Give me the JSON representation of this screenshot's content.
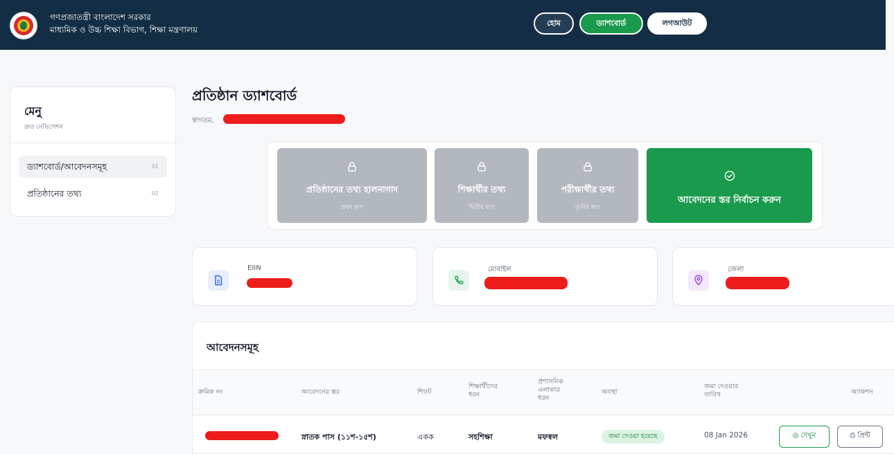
{
  "header": {
    "gov_title": "গণপ্রজাতন্ত্রী বাংলাদেশ সরকার",
    "gov_subtitle": "মাধ্যমিক ও উচ্চ শিক্ষা বিভাগ, শিক্ষা মন্ত্রণালয়",
    "nav": {
      "home": "হোম",
      "dashboard": "ড্যাশবোর্ড",
      "logout": "লগআউট"
    }
  },
  "sidebar": {
    "title": "মেনু",
    "subtitle": "দ্রুত নেভিগেশন",
    "items": [
      {
        "label": "ড্যাশবোর্ড/আবেদনসমূহ",
        "num": "01"
      },
      {
        "label": "প্রতিষ্ঠানের তথ্য",
        "num": "02"
      }
    ]
  },
  "main": {
    "title": "প্রতিষ্ঠান ড্যাশবোর্ড",
    "welcome": "স্বাগতম,"
  },
  "steps": [
    {
      "title": "প্রতিষ্ঠানের তথ্য হালনাগাদ",
      "subtitle": "প্রথম ধাপ"
    },
    {
      "title": "শিক্ষার্থীর তথ্য",
      "subtitle": "দ্বিতীয় ধাপ"
    },
    {
      "title": "পরীক্ষার্থীর তথ্য",
      "subtitle": "তৃতীয় ধাপ"
    },
    {
      "title": "আবেদনের স্তর নির্বাচন করুন"
    }
  ],
  "info": {
    "eiin_label": "EIIN",
    "mobile_label": "মোবাইল",
    "district_label": "জেলা"
  },
  "applications": {
    "title": "আবেদনসমূহ",
    "columns": {
      "serial": "ক্রমিক নং",
      "level": "আবেদনের স্তর",
      "shift": "শিফট",
      "student_type_1": "শিক্ষার্থীদের",
      "student_type_2": "ধরন",
      "area_1": "প্রশাসনিক",
      "area_2": "এলাকার",
      "area_3": "ধরন",
      "status": "অবস্থা",
      "date_1": "জমা দেওয়ার",
      "date_2": "তারিখ",
      "action": "অ্যাকশন"
    },
    "rows": [
      {
        "level": "স্নাতক পাস (১১শ-১৫শ)",
        "shift": "একক",
        "student_type": "সহশিক্ষা",
        "area": "মফস্বল",
        "status": "জমা দেওয়া হয়েছে",
        "date": "08 Jan 2026",
        "view": "দেখুন",
        "print": "প্রিন্ট"
      }
    ]
  },
  "colors": {
    "header_bg": "#132d44",
    "accent_green": "#1a9a4c",
    "locked_gray": "#b3b8bf",
    "redaction": "#ee1c1c"
  }
}
